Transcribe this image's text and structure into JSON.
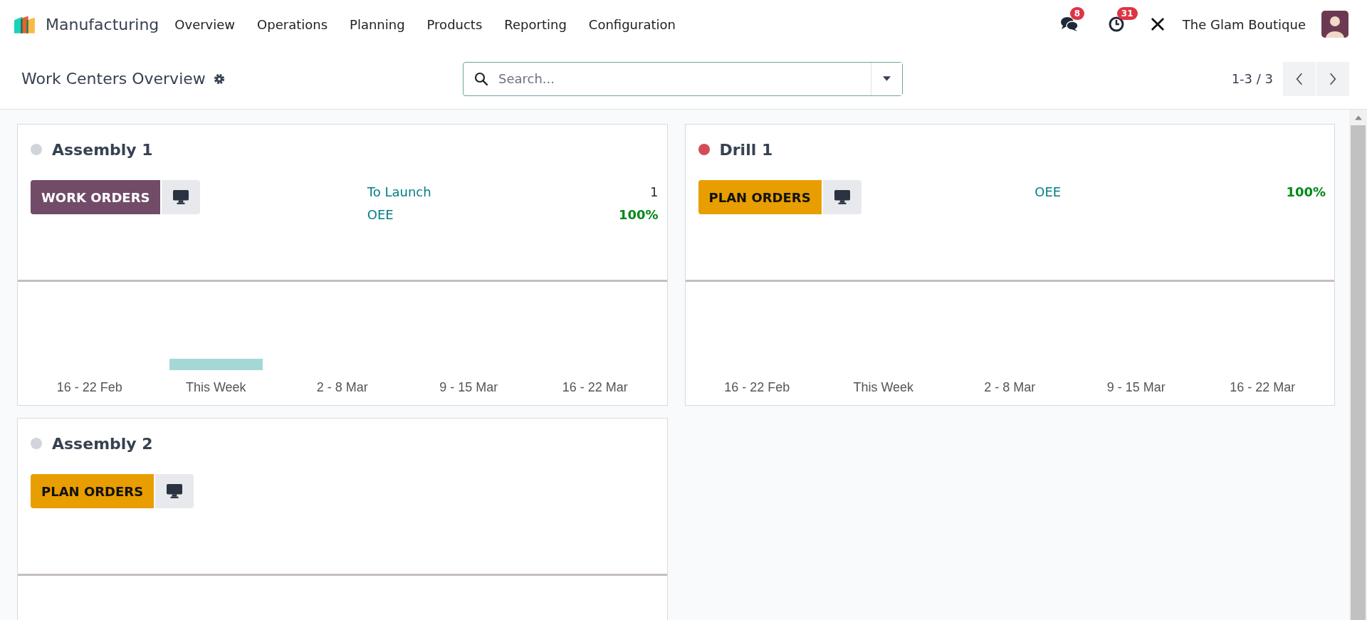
{
  "navbar": {
    "app_name": "Manufacturing",
    "menu": [
      "Overview",
      "Operations",
      "Planning",
      "Products",
      "Reporting",
      "Configuration"
    ],
    "messages_badge": "8",
    "activities_badge": "31",
    "company": "The Glam Boutique"
  },
  "control_panel": {
    "title": "Work Centers Overview",
    "search": {
      "placeholder": "Search..."
    },
    "pager": "1-3 / 3"
  },
  "cards": [
    {
      "name": "Assembly 1",
      "color": "#d1d5db",
      "button": {
        "kind": "work",
        "label": "WORK ORDERS"
      },
      "stats": [
        {
          "label": "To Launch",
          "value": "1",
          "kind": "count"
        },
        {
          "label": "OEE",
          "value": "100%",
          "kind": "percent"
        }
      ],
      "weeks": [
        {
          "label": "16 - 22 Feb",
          "bar": false
        },
        {
          "label": "This Week",
          "bar": true
        },
        {
          "label": "2 - 8 Mar",
          "bar": false
        },
        {
          "label": "9 - 15 Mar",
          "bar": false
        },
        {
          "label": "16 - 22 Mar",
          "bar": false
        }
      ]
    },
    {
      "name": "Drill 1",
      "color": "#d44c59",
      "button": {
        "kind": "plan",
        "label": "PLAN ORDERS"
      },
      "stats": [
        {
          "label": "OEE",
          "value": "100%",
          "kind": "percent"
        }
      ],
      "weeks": [
        {
          "label": "16 - 22 Feb",
          "bar": false
        },
        {
          "label": "This Week",
          "bar": false
        },
        {
          "label": "2 - 8 Mar",
          "bar": false
        },
        {
          "label": "9 - 15 Mar",
          "bar": false
        },
        {
          "label": "16 - 22 Mar",
          "bar": false
        }
      ]
    },
    {
      "name": "Assembly 2",
      "color": "#d1d5db",
      "button": {
        "kind": "plan",
        "label": "PLAN ORDERS"
      }
    }
  ]
}
